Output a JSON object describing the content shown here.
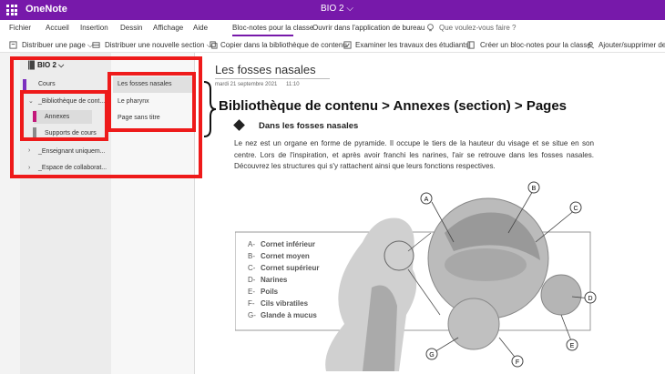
{
  "titlebar": {
    "app_name": "OneNote",
    "doc_name": "BIO 2 ⌵"
  },
  "tabs": [
    {
      "label": "Fichier"
    },
    {
      "label": "Accueil"
    },
    {
      "label": "Insertion"
    },
    {
      "label": "Dessin"
    },
    {
      "label": "Affichage"
    },
    {
      "label": "Aide"
    },
    {
      "label": "Bloc-notes pour la classe"
    },
    {
      "label": "Ouvrir dans l'application de bureau"
    },
    {
      "label": "Que voulez-vous faire ?"
    }
  ],
  "commands": [
    {
      "label": "Distribuer une page ⌵"
    },
    {
      "label": "Distribuer une nouvelle section ⌵"
    },
    {
      "label": "Copier dans la bibliothèque de contenu"
    },
    {
      "label": "Examiner les travaux des étudiants"
    },
    {
      "label": "Créer un bloc-notes pour la classe"
    },
    {
      "label": "Ajouter/supprimer des"
    }
  ],
  "notebook": {
    "name": "BIO 2 ⌵"
  },
  "sections": [
    {
      "label": "Cours"
    },
    {
      "label": "_Bibliothèque de cont..."
    },
    {
      "label": "Annexes"
    },
    {
      "label": "Supports de cours"
    },
    {
      "label": "_Enseignant uniquem..."
    },
    {
      "label": "_Espace de collaborat..."
    }
  ],
  "pages": [
    {
      "label": "Les fosses nasales"
    },
    {
      "label": "Le pharynx"
    },
    {
      "label": "Page sans titre"
    }
  ],
  "annotation": {
    "text": "Bibliothèque de contenu > Annexes (section) > Pages"
  },
  "page": {
    "title": "Les fosses nasales",
    "date": "mardi 21 septembre 2021",
    "time": "11:10",
    "heading": "Dans les fosses nasales",
    "paragraph": "Le nez est un organe en forme de pyramide. Il occupe le tiers de la hauteur du visage et se situe en son centre. Lors de l'inspiration, et après avoir franchi les narines, l'air se retrouve dans les fosses nasales. Découvrez les structures qui s'y rattachent ainsi que leurs fonctions respectives.",
    "legend": [
      {
        "letter": "A-",
        "text": "Cornet inférieur"
      },
      {
        "letter": "B-",
        "text": "Cornet moyen"
      },
      {
        "letter": "C-",
        "text": "Cornet supérieur"
      },
      {
        "letter": "D-",
        "text": "Narines"
      },
      {
        "letter": "E-",
        "text": "Poils"
      },
      {
        "letter": "F-",
        "text": "Cils vibratiles"
      },
      {
        "letter": "G-",
        "text": "Glande à mucus"
      }
    ],
    "callouts": [
      "A",
      "B",
      "C",
      "D",
      "E",
      "F",
      "G"
    ]
  },
  "colors": {
    "brand": "#7719aa",
    "annotation_red": "#ee1a1a",
    "section_cours": "#7b2fbe",
    "section_annexes": "#c3197a",
    "section_supports": "#8a8a8a"
  },
  "icons": [
    "waffle-icon",
    "lightbulb-icon",
    "distribute-page-icon",
    "distribute-section-icon",
    "copy-library-icon",
    "review-icon",
    "create-notebook-icon",
    "add-remove-icon",
    "notebook-icon"
  ]
}
